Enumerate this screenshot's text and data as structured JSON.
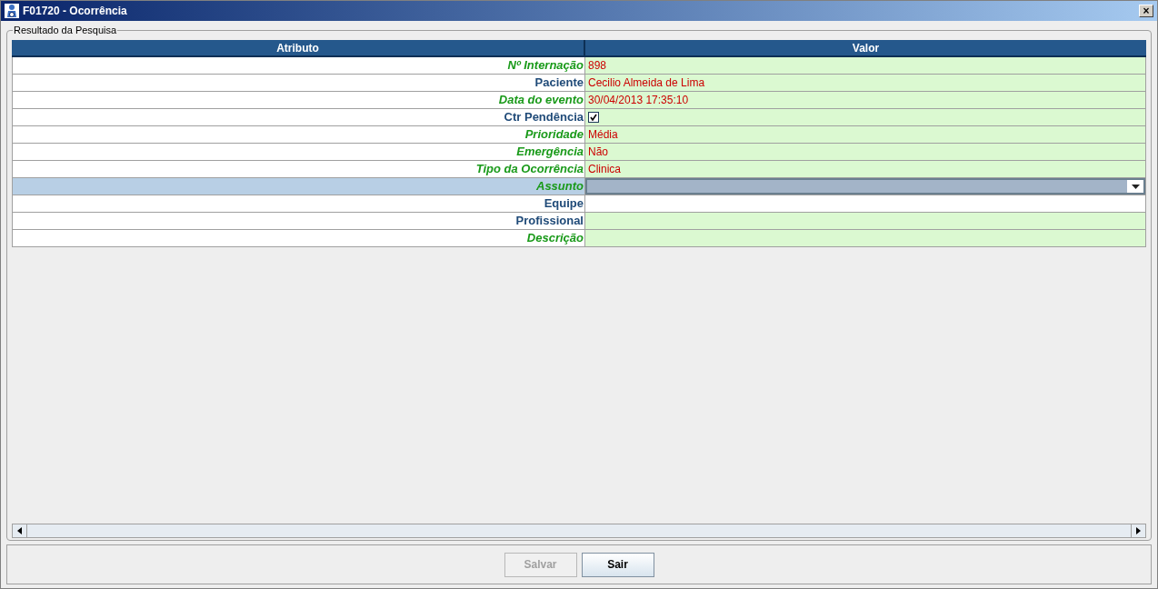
{
  "window": {
    "title": "F01720 - Ocorrência",
    "close": "×"
  },
  "group": {
    "title": "Resultado da Pesquisa"
  },
  "table": {
    "columns": [
      "Atributo",
      "Valor"
    ],
    "rows": [
      {
        "label": "Nº Internação",
        "required": true,
        "kind": "text",
        "value": "898",
        "selected": false
      },
      {
        "label": "Paciente",
        "required": false,
        "kind": "text",
        "value": "Cecilio Almeida de Lima",
        "selected": false
      },
      {
        "label": "Data do evento",
        "required": true,
        "kind": "text",
        "value": "30/04/2013 17:35:10",
        "selected": false
      },
      {
        "label": "Ctr Pendência",
        "required": false,
        "kind": "checkbox",
        "checked": true,
        "selected": false
      },
      {
        "label": "Prioridade",
        "required": true,
        "kind": "text",
        "value": "Média",
        "selected": false
      },
      {
        "label": "Emergência",
        "required": true,
        "kind": "text",
        "value": "Não",
        "selected": false
      },
      {
        "label": "Tipo da Ocorrência",
        "required": true,
        "kind": "text",
        "value": "Clinica",
        "selected": false
      },
      {
        "label": "Assunto",
        "required": true,
        "kind": "dropdown",
        "selected": true
      },
      {
        "label": "Equipe",
        "required": false,
        "kind": "plain",
        "selected": false
      },
      {
        "label": "Profissional",
        "required": false,
        "kind": "input",
        "selected": false
      },
      {
        "label": "Descrição",
        "required": true,
        "kind": "input",
        "selected": false
      }
    ]
  },
  "buttons": [
    {
      "label": "Salvar",
      "disabled": true
    },
    {
      "label": "Sair",
      "disabled": false
    }
  ]
}
